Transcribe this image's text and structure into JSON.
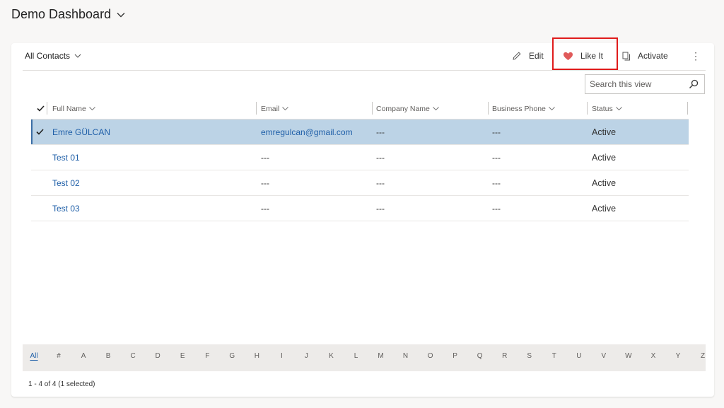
{
  "dashboard": {
    "title": "Demo Dashboard"
  },
  "view": {
    "name": "All Contacts"
  },
  "commands": {
    "edit": "Edit",
    "like": "Like It",
    "activate": "Activate"
  },
  "search": {
    "placeholder": "Search this view"
  },
  "columns": [
    "Full Name",
    "Email",
    "Company Name",
    "Business Phone",
    "Status"
  ],
  "rows": [
    {
      "name": "Emre GÜLCAN",
      "email": "emregulcan@gmail.com",
      "company": "---",
      "phone": "---",
      "status": "Active",
      "selected": true
    },
    {
      "name": "Test 01",
      "email": "---",
      "company": "---",
      "phone": "---",
      "status": "Active",
      "selected": false
    },
    {
      "name": "Test 02",
      "email": "---",
      "company": "---",
      "phone": "---",
      "status": "Active",
      "selected": false
    },
    {
      "name": "Test 03",
      "email": "---",
      "company": "---",
      "phone": "---",
      "status": "Active",
      "selected": false
    }
  ],
  "jump_bar": [
    "All",
    "#",
    "A",
    "B",
    "C",
    "D",
    "E",
    "F",
    "G",
    "H",
    "I",
    "J",
    "K",
    "L",
    "M",
    "N",
    "O",
    "P",
    "Q",
    "R",
    "S",
    "T",
    "U",
    "V",
    "W",
    "X",
    "Y",
    "Z"
  ],
  "footer": {
    "status": "1 - 4 of 4 (1 selected)"
  },
  "colors": {
    "accent": "#1f5fa8",
    "selected_row": "#bcd3e6",
    "highlight": "#e01b1b",
    "heart": "#e05a5a"
  }
}
